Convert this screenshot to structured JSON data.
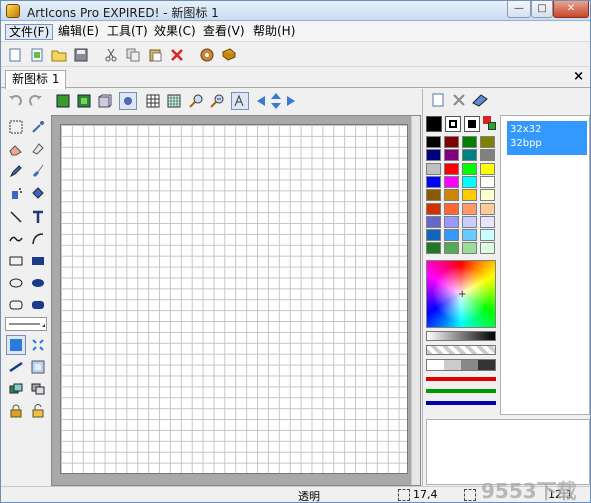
{
  "window": {
    "title": "ArtIcons Pro EXPIRED! - 新图标 1",
    "min": "—",
    "max": "□",
    "close": "✕"
  },
  "menu": [
    {
      "label": "文件(F)"
    },
    {
      "label": "编辑(E)"
    },
    {
      "label": "工具(T)"
    },
    {
      "label": "效果(C)"
    },
    {
      "label": "查看(V)"
    },
    {
      "label": "帮助(H)"
    }
  ],
  "toolbar": [
    "new-icon",
    "new-icon-2",
    "open-folder-icon",
    "save-icon",
    "cut-icon",
    "copy-icon",
    "paste-icon",
    "delete-icon",
    "wizard-icon",
    "book-icon"
  ],
  "tabs": [
    {
      "label": "新图标 1"
    }
  ],
  "tab_close": "×",
  "edit_tools": [
    "undo-icon",
    "redo-icon",
    "layer-green-icon",
    "layer-green-2-icon",
    "layer-box-icon",
    "select-all-icon",
    "grid-icon",
    "grid-2-icon",
    "zoom-in-icon",
    "zoom-out-icon",
    "text-aa-icon",
    "arrow-left-icon",
    "arrow-updown-icon",
    "arrow-right-icon"
  ],
  "sizes": [
    {
      "line1": "32x32",
      "line2": "32bpp"
    }
  ],
  "palette": {
    "rows": [
      [
        "#000000",
        "#800000",
        "#008000",
        "#808000"
      ],
      [
        "#000080",
        "#800080",
        "#008080",
        "#808080"
      ],
      [
        "#c0c0c0",
        "#ff0000",
        "#00ff00",
        "#ffff00"
      ],
      [
        "#0000ff",
        "#ff00ff",
        "#00ffff",
        "#ffffff"
      ],
      [
        "#8b5a00",
        "#cc8800",
        "#ffcc00",
        "#ffffcc"
      ],
      [
        "#cc3300",
        "#ff6633",
        "#ff9966",
        "#ffcc99"
      ],
      [
        "#6666cc",
        "#9999ff",
        "#ccccff",
        "#e6e6ff"
      ],
      [
        "#1166bb",
        "#3399ff",
        "#66ccff",
        "#ccffff"
      ],
      [
        "#227722",
        "#55aa55",
        "#99dd99",
        "#ddffdd"
      ]
    ]
  },
  "status": {
    "mode": "透明",
    "coords": "17,4",
    "zoom": "12:1"
  },
  "watermark": "9553下载"
}
